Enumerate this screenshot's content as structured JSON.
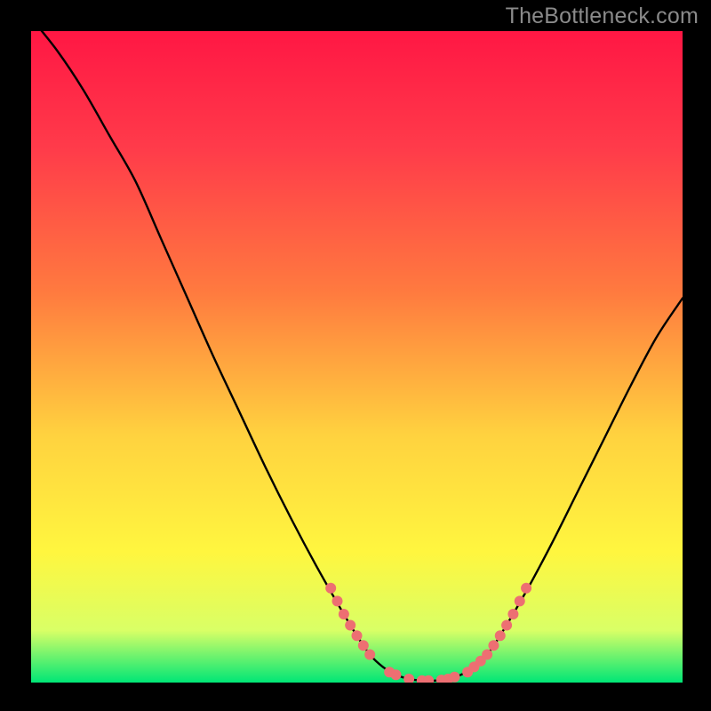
{
  "watermark": "TheBottleneck.com",
  "colors": {
    "page_bg": "#000000",
    "curve": "#000000",
    "marker": "#ed6f72",
    "gradient_stops": [
      {
        "offset": "0%",
        "color": "#ff1744"
      },
      {
        "offset": "18%",
        "color": "#ff3b4a"
      },
      {
        "offset": "40%",
        "color": "#ff7a3f"
      },
      {
        "offset": "62%",
        "color": "#ffd23f"
      },
      {
        "offset": "80%",
        "color": "#fff63f"
      },
      {
        "offset": "92%",
        "color": "#d9ff66"
      },
      {
        "offset": "100%",
        "color": "#00e676"
      }
    ]
  },
  "chart_data": {
    "type": "line",
    "title": "",
    "xlabel": "",
    "ylabel": "",
    "xlim": [
      0,
      100
    ],
    "ylim": [
      0,
      100
    ],
    "curve": [
      {
        "x": 0,
        "y": 102
      },
      {
        "x": 4,
        "y": 97
      },
      {
        "x": 8,
        "y": 91
      },
      {
        "x": 12,
        "y": 84
      },
      {
        "x": 16,
        "y": 77
      },
      {
        "x": 20,
        "y": 68
      },
      {
        "x": 24,
        "y": 59
      },
      {
        "x": 28,
        "y": 50
      },
      {
        "x": 32,
        "y": 41.5
      },
      {
        "x": 36,
        "y": 33
      },
      {
        "x": 40,
        "y": 25
      },
      {
        "x": 44,
        "y": 17.5
      },
      {
        "x": 48,
        "y": 10.5
      },
      {
        "x": 50,
        "y": 7.2
      },
      {
        "x": 52,
        "y": 4.3
      },
      {
        "x": 54,
        "y": 2.4
      },
      {
        "x": 56,
        "y": 1.2
      },
      {
        "x": 58,
        "y": 0.55
      },
      {
        "x": 60,
        "y": 0.3
      },
      {
        "x": 62,
        "y": 0.3
      },
      {
        "x": 64,
        "y": 0.55
      },
      {
        "x": 66,
        "y": 1.2
      },
      {
        "x": 68,
        "y": 2.4
      },
      {
        "x": 70,
        "y": 4.3
      },
      {
        "x": 72,
        "y": 7.2
      },
      {
        "x": 76,
        "y": 14
      },
      {
        "x": 80,
        "y": 21.5
      },
      {
        "x": 84,
        "y": 29.5
      },
      {
        "x": 88,
        "y": 37.5
      },
      {
        "x": 92,
        "y": 45.5
      },
      {
        "x": 96,
        "y": 53
      },
      {
        "x": 100,
        "y": 59
      }
    ],
    "markers": [
      {
        "x": 46,
        "y": 14.5
      },
      {
        "x": 47,
        "y": 12.5
      },
      {
        "x": 48,
        "y": 10.5
      },
      {
        "x": 49,
        "y": 8.8
      },
      {
        "x": 50,
        "y": 7.2
      },
      {
        "x": 51,
        "y": 5.7
      },
      {
        "x": 52,
        "y": 4.3
      },
      {
        "x": 55,
        "y": 1.6
      },
      {
        "x": 56,
        "y": 1.2
      },
      {
        "x": 58,
        "y": 0.55
      },
      {
        "x": 60,
        "y": 0.3
      },
      {
        "x": 61,
        "y": 0.3
      },
      {
        "x": 63,
        "y": 0.4
      },
      {
        "x": 64,
        "y": 0.55
      },
      {
        "x": 65,
        "y": 0.85
      },
      {
        "x": 67,
        "y": 1.6
      },
      {
        "x": 68,
        "y": 2.4
      },
      {
        "x": 69,
        "y": 3.3
      },
      {
        "x": 70,
        "y": 4.3
      },
      {
        "x": 71,
        "y": 5.7
      },
      {
        "x": 72,
        "y": 7.2
      },
      {
        "x": 73,
        "y": 8.8
      },
      {
        "x": 74,
        "y": 10.5
      },
      {
        "x": 75,
        "y": 12.5
      },
      {
        "x": 76,
        "y": 14.5
      }
    ],
    "marker_radius_px": 6.0
  }
}
